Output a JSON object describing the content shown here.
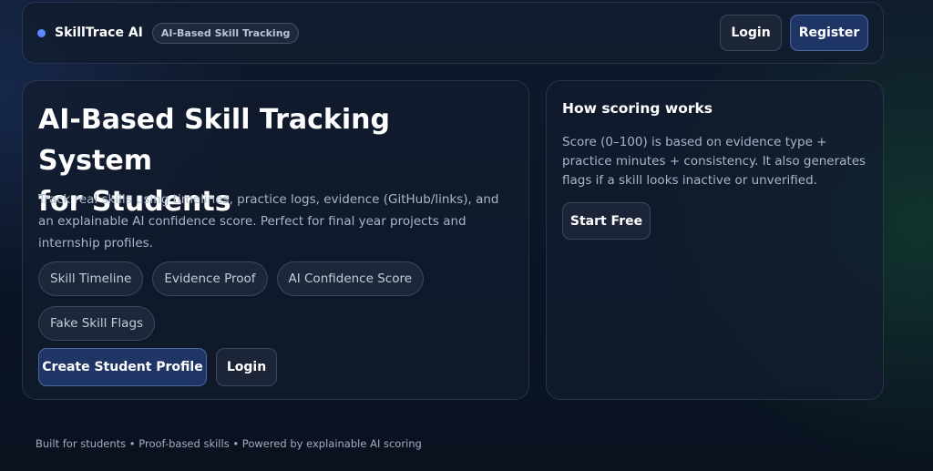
{
  "header": {
    "brand_name": "SkillTrace AI",
    "badge": "AI-Based Skill Tracking",
    "login_label": "Login",
    "register_label": "Register"
  },
  "hero": {
    "title_line1": "AI-Based Skill Tracking System",
    "title_line2": "for Students",
    "description": "Track real skills using timelines, practice logs, evidence (GitHub/links), and an explainable AI confidence score. Perfect for final year projects and internship profiles.",
    "chips": [
      "Skill Timeline",
      "Evidence Proof",
      "AI Confidence Score",
      "Fake Skill Flags"
    ],
    "create_profile_label": "Create Student Profile",
    "login_label": "Login"
  },
  "scoring": {
    "title": "How scoring works",
    "description": "Score (0–100) is based on evidence type + practice minutes + consistency. It also generates flags if a skill looks inactive or unverified.",
    "start_label": "Start Free"
  },
  "footer": {
    "text": "Built for students • Proof-based skills • Powered by explainable AI scoring"
  },
  "colors": {
    "accent": "#5b8cff",
    "primary_button": "#1f3566",
    "background": "#0b1424"
  },
  "icons": {
    "brand": "brand-dot-icon"
  }
}
